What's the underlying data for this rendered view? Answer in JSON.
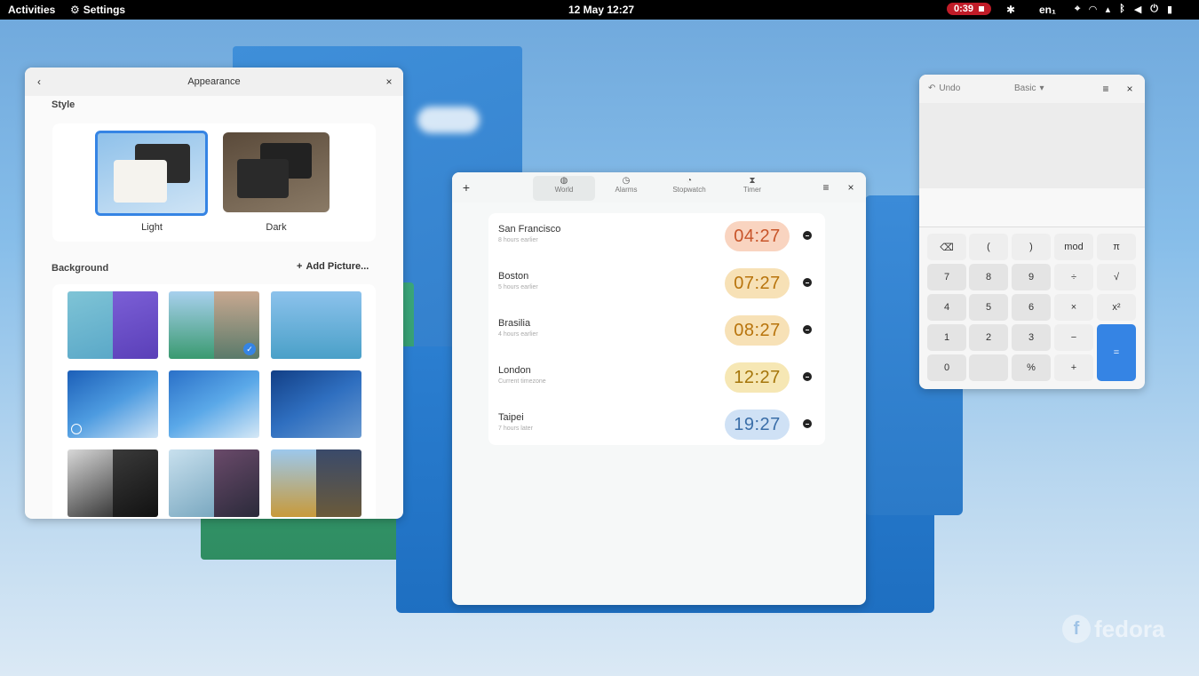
{
  "topbar": {
    "activities": "Activities",
    "app_name": "Settings",
    "clock": "12 May  12:27",
    "recording_time": "0:39",
    "keyboard_lang": "en₁"
  },
  "appearance": {
    "title": "Appearance",
    "style_label": "Style",
    "light_label": "Light",
    "dark_label": "Dark",
    "background_label": "Background",
    "add_picture": "Add Picture..."
  },
  "clocks": {
    "tabs": [
      "World",
      "Alarms",
      "Stopwatch",
      "Timer"
    ],
    "cities": [
      {
        "name": "San Francisco",
        "sub": "8 hours earlier",
        "time": "04:27",
        "color": "#f9d4c0",
        "text": "#c8552a"
      },
      {
        "name": "Boston",
        "sub": "5 hours earlier",
        "time": "07:27",
        "color": "#f7e1b6",
        "text": "#b8740c"
      },
      {
        "name": "Brasilia",
        "sub": "4 hours earlier",
        "time": "08:27",
        "color": "#f7e1b6",
        "text": "#b8740c"
      },
      {
        "name": "London",
        "sub": "Current timezone",
        "time": "12:27",
        "color": "#f6e7b4",
        "text": "#a5760a"
      },
      {
        "name": "Taipei",
        "sub": "7 hours later",
        "time": "19:27",
        "color": "#cfe1f5",
        "text": "#3a6ea8"
      }
    ]
  },
  "calculator": {
    "undo": "Undo",
    "mode": "Basic",
    "keys": {
      "backspace": "⌫",
      "lparen": "(",
      "rparen": ")",
      "mod": "mod",
      "pi": "π",
      "k7": "7",
      "k8": "8",
      "k9": "9",
      "div": "÷",
      "sqrt": "√",
      "k4": "4",
      "k5": "5",
      "k6": "6",
      "mul": "×",
      "sq": "x²",
      "k1": "1",
      "k2": "2",
      "k3": "3",
      "minus": "−",
      "k0": "0",
      "pct": "%",
      "plus": "+",
      "eq": "="
    }
  },
  "watermark": "fedora",
  "colors": {
    "accent": "#3584e4",
    "topbar": "#000000",
    "record": "#c01c28"
  }
}
